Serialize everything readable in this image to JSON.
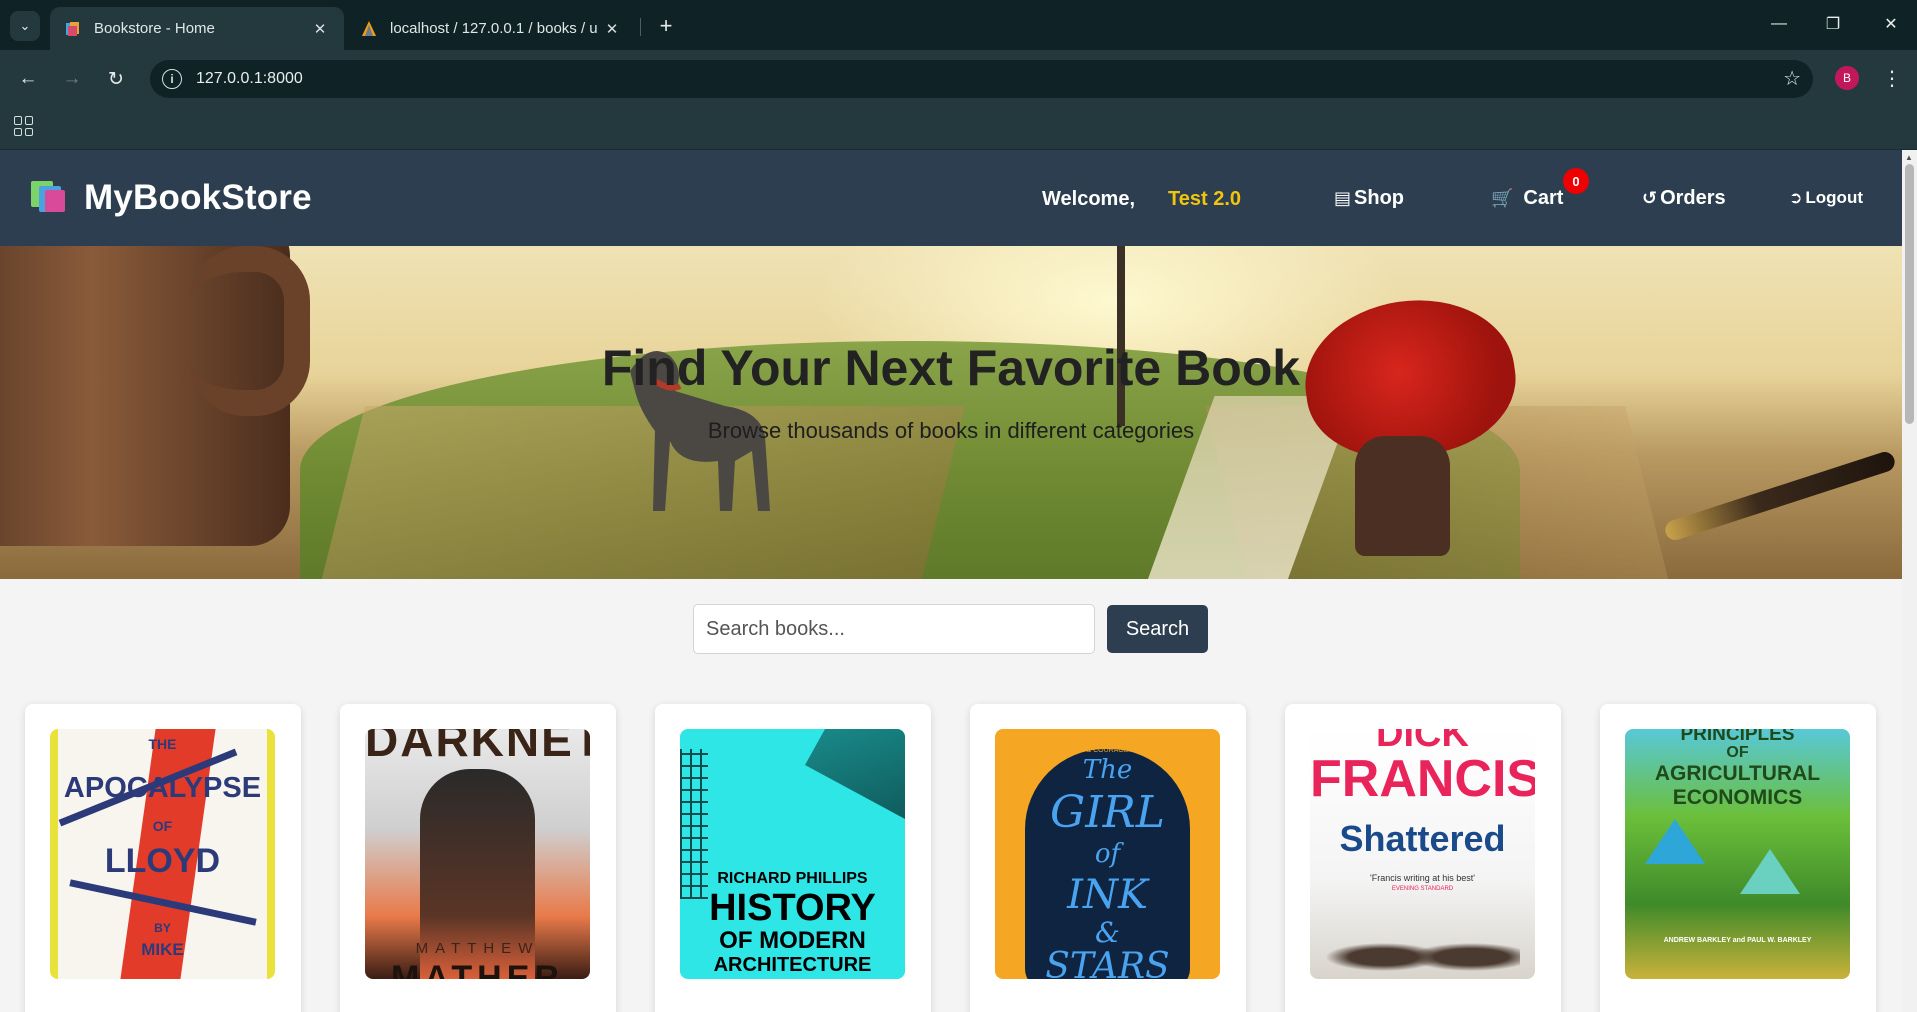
{
  "browser": {
    "tabs": [
      {
        "title": "Bookstore - Home",
        "active": true
      },
      {
        "title": "localhost / 127.0.0.1 / books / u",
        "active": false
      }
    ],
    "url": "127.0.0.1:8000",
    "profile_initial": "B"
  },
  "site": {
    "brand": "MyBookStore",
    "welcome_label": "Welcome,",
    "username": "Test 2.0",
    "nav": {
      "shop": "Shop",
      "cart": "Cart",
      "cart_count": "0",
      "orders": "Orders",
      "logout": "Logout"
    },
    "colors": {
      "nav_bg": "#2c3e50",
      "username": "#f1c40f",
      "badge": "#ee0000"
    }
  },
  "hero": {
    "title": "Find Your Next Favorite Book",
    "subtitle": "Browse thousands of books in different categories"
  },
  "search": {
    "placeholder": "Search books...",
    "value": "",
    "button": "Search"
  },
  "books": [
    {
      "cover_lines": [
        "THE",
        "APOCALYPSE",
        "OF",
        "LLOYD",
        "BY",
        "MIKE"
      ]
    },
    {
      "cover_lines": [
        "DARKNET",
        "MATTHEW",
        "MATHER"
      ]
    },
    {
      "cover_lines": [
        "RICHARD PHILLIPS",
        "HISTORY",
        "OF MODERN",
        "ARCHITECTURE"
      ]
    },
    {
      "cover_lines": [
        "A TALE",
        "OF WONDER",
        "& COURAGE",
        "The",
        "GIRL",
        "of",
        "INK",
        "&",
        "STARS"
      ]
    },
    {
      "cover_lines": [
        "DICK",
        "FRANCIS",
        "Shattered",
        "'Francis writing at his best'",
        "EVENING STANDARD"
      ]
    },
    {
      "cover_lines": [
        "PRINCIPLES",
        "OF",
        "AGRICULTURAL",
        "ECONOMICS",
        "ANDREW BARKLEY and PAUL W. BARKLEY"
      ]
    }
  ]
}
